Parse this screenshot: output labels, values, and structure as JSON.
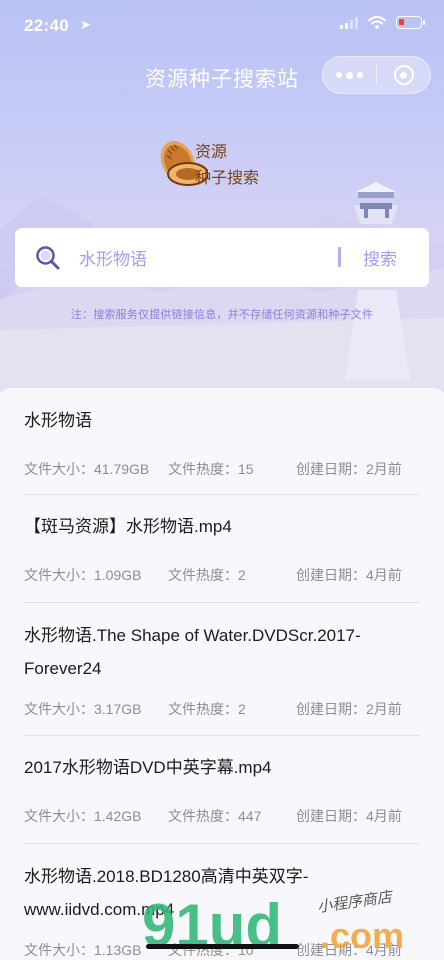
{
  "status_bar": {
    "time": "22:40"
  },
  "nav": {
    "title": "资源种子搜索站"
  },
  "logo": {
    "line1": "资源",
    "line2": "种子搜索"
  },
  "search": {
    "value": "水形物语",
    "button_label": "搜索"
  },
  "note": "注：搜索服务仅提供链接信息，并不存储任何资源和种子文件",
  "labels": {
    "size": "文件大小：",
    "heat": "文件热度：",
    "date": "创建日期："
  },
  "results": [
    {
      "title": "水形物语",
      "size": "41.79GB",
      "heat": "15",
      "date": "2月前"
    },
    {
      "title": "【斑马资源】水形物语.mp4",
      "size": "1.09GB",
      "heat": "2",
      "date": "4月前"
    },
    {
      "title": "水形物语.The Shape of Water.DVDScr.2017-Forever24",
      "size": "3.17GB",
      "heat": "2",
      "date": "2月前"
    },
    {
      "title": "2017水形物语DVD中英字幕.mp4",
      "size": "1.42GB",
      "heat": "447",
      "date": "4月前"
    },
    {
      "title": "水形物语.2018.BD1280高清中英双字-www.iidvd.com.mp4",
      "size": "1.13GB",
      "heat": "10",
      "date": "4月前"
    }
  ],
  "watermark": {
    "brand": "91ud",
    "suffix": ".com",
    "tagline": "小程序商店"
  },
  "colors": {
    "accent": "#a69bf0",
    "hero_top": "#b9c2f4",
    "battery_low": "#ff3b30"
  }
}
